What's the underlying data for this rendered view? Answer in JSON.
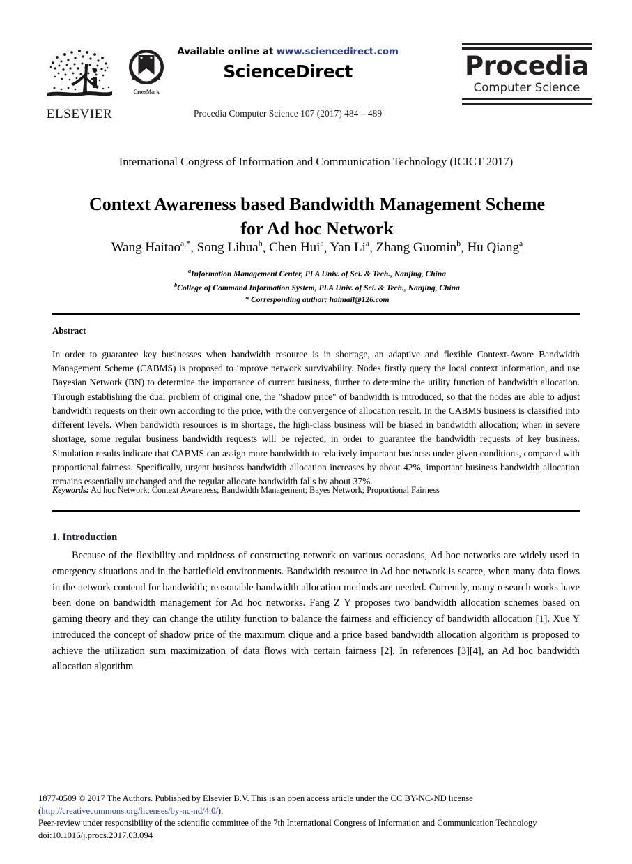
{
  "header": {
    "elsevier_logo_label": "ELSEVIER",
    "crossmark_label": "CrossMark",
    "available_online_prefix": "Available online at ",
    "sciencedirect_url": "www.sciencedirect.com",
    "sciencedirect_wordmark": "ScienceDirect",
    "journal_reference": "Procedia Computer Science 107 (2017) 484 – 489",
    "procedia_name": "Procedia",
    "procedia_subtitle": "Computer Science"
  },
  "title_block": {
    "conference": "International Congress of Information and Communication Technology (ICICT 2017)",
    "title": "Context Awareness based Bandwidth Management Scheme for Ad hoc Network",
    "authors_plain": "Wang Haitao a,*, Song Lihua b, Chen Hui a, Yan Li a, Zhang Guomin b, Hu Qiang a",
    "authors": [
      {
        "name": "Wang Haitao",
        "sup": "a,*"
      },
      {
        "name": "Song Lihua",
        "sup": "b"
      },
      {
        "name": "Chen Hui",
        "sup": "a"
      },
      {
        "name": "Yan Li",
        "sup": "a"
      },
      {
        "name": "Zhang Guomin",
        "sup": "b"
      },
      {
        "name": "Hu Qiang",
        "sup": "a"
      }
    ],
    "affiliations": [
      {
        "sup": "a",
        "text": "Information Management Center, PLA Univ. of Sci. & Tech.,  Nanjing, China"
      },
      {
        "sup": "b",
        "text": "College of Command Information System, PLA Univ. of Sci. & Tech.,  Nanjing, China"
      }
    ],
    "corresponding": "* Corresponding author: haimail@126.com"
  },
  "abstract": {
    "heading": "Abstract",
    "body": "In order to guarantee key businesses when bandwidth resource is in shortage, an adaptive and flexible Context-Aware Bandwidth Management Scheme (CABMS) is proposed to improve network survivability. Nodes firstly query the local context information, and use Bayesian Network (BN) to determine the importance of current business, further to determine the utility function of bandwidth allocation. Through establishing the dual problem of original one, the \"shadow price\" of bandwidth is introduced, so that the nodes are able to adjust bandwidth requests on their own according to the price, with the convergence of allocation result. In the CABMS business is classified into different levels. When bandwidth resources is in shortage, the high-class business will be biased in bandwidth allocation; when in severe shortage, some regular business bandwidth requests will be rejected, in order to guarantee the bandwidth requests of key business. Simulation results indicate that CABMS can assign more bandwidth to relatively important business under given conditions, compared with proportional fairness. Specifically, urgent business bandwidth allocation increases by about 42%, important business bandwidth allocation remains essentially unchanged and the regular allocate bandwidth falls by about 37%.",
    "keywords_label": "Keywords:",
    "keywords_text": " Ad hoc Network; Context Awareness; Bandwidth Management; Bayes Network; Proportional Fairness"
  },
  "introduction": {
    "heading": "1. Introduction",
    "body": "Because of the flexibility and rapidness of constructing network on various occasions, Ad hoc networks are widely used in emergency situations and in the battlefield environments. Bandwidth resource in Ad hoc network is scarce, when many data flows in the network contend for bandwidth; reasonable bandwidth allocation methods are needed. Currently, many research works have been done on bandwidth management for Ad hoc networks. Fang Z Y proposes two bandwidth allocation schemes based on gaming theory and they can change the utility function to balance the fairness and efficiency of bandwidth allocation [1]. Xue Y introduced the concept of shadow price of the maximum clique and a price based bandwidth allocation algorithm is proposed to achieve the utilization sum maximization of data flows with certain fairness [2]. In references [3][4], an Ad hoc bandwidth allocation algorithm"
  },
  "footer": {
    "copyright_line": "1877-0509 © 2017 The Authors. Published by Elsevier B.V. This is an open access article under the CC BY-NC-ND license",
    "license_open_paren": "(",
    "license_url": "http://creativecommons.org/licenses/by-nc-nd/4.0/",
    "license_close_paren": ").",
    "peer_review_line": "Peer-review under responsibility of the scientific committee of the 7th International Congress of Information and Communication Technology",
    "doi_line": "doi:10.1016/j.procs.2017.03.094"
  },
  "colors": {
    "link_blue": "#2a3b8f",
    "procedia_dark": "#231f20",
    "text_black": "#000000"
  }
}
